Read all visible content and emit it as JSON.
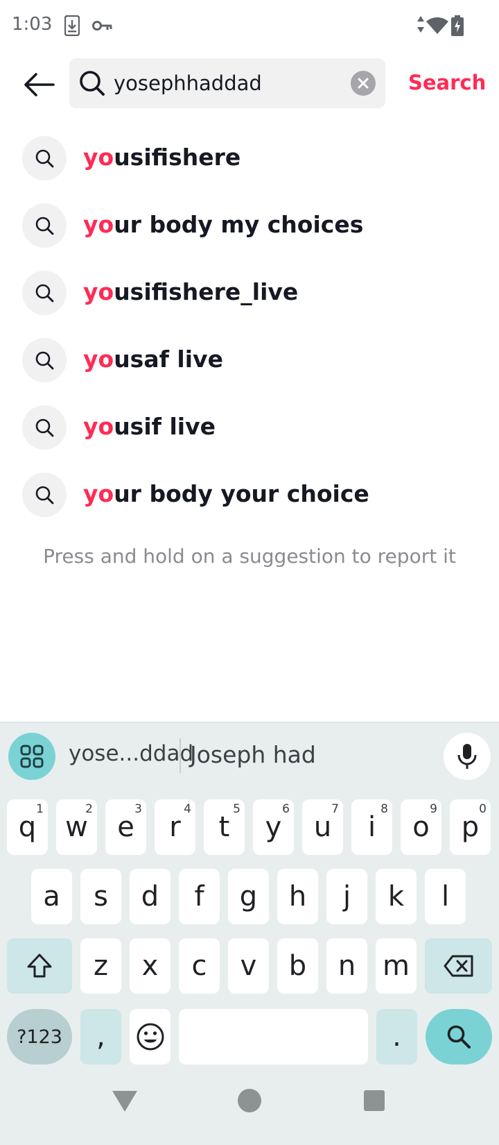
{
  "status_bar": {
    "time": "1:03",
    "icons": [
      "download-icon",
      "vpn-key-icon",
      "data-arrows-icon",
      "wifi-icon",
      "battery-charging-icon"
    ]
  },
  "header": {
    "back_icon": "arrow-left-icon",
    "search_icon": "search-icon",
    "query": "yosephhaddad",
    "clear_icon": "clear-circle-icon",
    "search_label": "Search"
  },
  "suggestions": [
    {
      "prefix": "yo",
      "rest": "usifishere"
    },
    {
      "prefix": "yo",
      "rest": "ur body my choices"
    },
    {
      "prefix": "yo",
      "rest": "usifishere_live"
    },
    {
      "prefix": "yo",
      "rest": "usaf live"
    },
    {
      "prefix": "yo",
      "rest": "usif live"
    },
    {
      "prefix": "yo",
      "rest": "ur body your choice"
    }
  ],
  "hint": "Press and hold on a suggestion to report it",
  "keyboard": {
    "suggestions": [
      "yose...ddad",
      "Joseph had"
    ],
    "row1": [
      {
        "k": "q",
        "n": "1"
      },
      {
        "k": "w",
        "n": "2"
      },
      {
        "k": "e",
        "n": "3"
      },
      {
        "k": "r",
        "n": "4"
      },
      {
        "k": "t",
        "n": "5"
      },
      {
        "k": "y",
        "n": "6"
      },
      {
        "k": "u",
        "n": "7"
      },
      {
        "k": "i",
        "n": "8"
      },
      {
        "k": "o",
        "n": "9"
      },
      {
        "k": "p",
        "n": "0"
      }
    ],
    "row2": [
      "a",
      "s",
      "d",
      "f",
      "g",
      "h",
      "j",
      "k",
      "l"
    ],
    "row3": [
      "z",
      "x",
      "c",
      "v",
      "b",
      "n",
      "m"
    ],
    "symbols_label": "?123",
    "comma": ",",
    "period": "."
  },
  "colors": {
    "accent": "#fe2c55",
    "keyboard_bg": "#e8eeee",
    "keyboard_accent": "#7bd2d4"
  }
}
